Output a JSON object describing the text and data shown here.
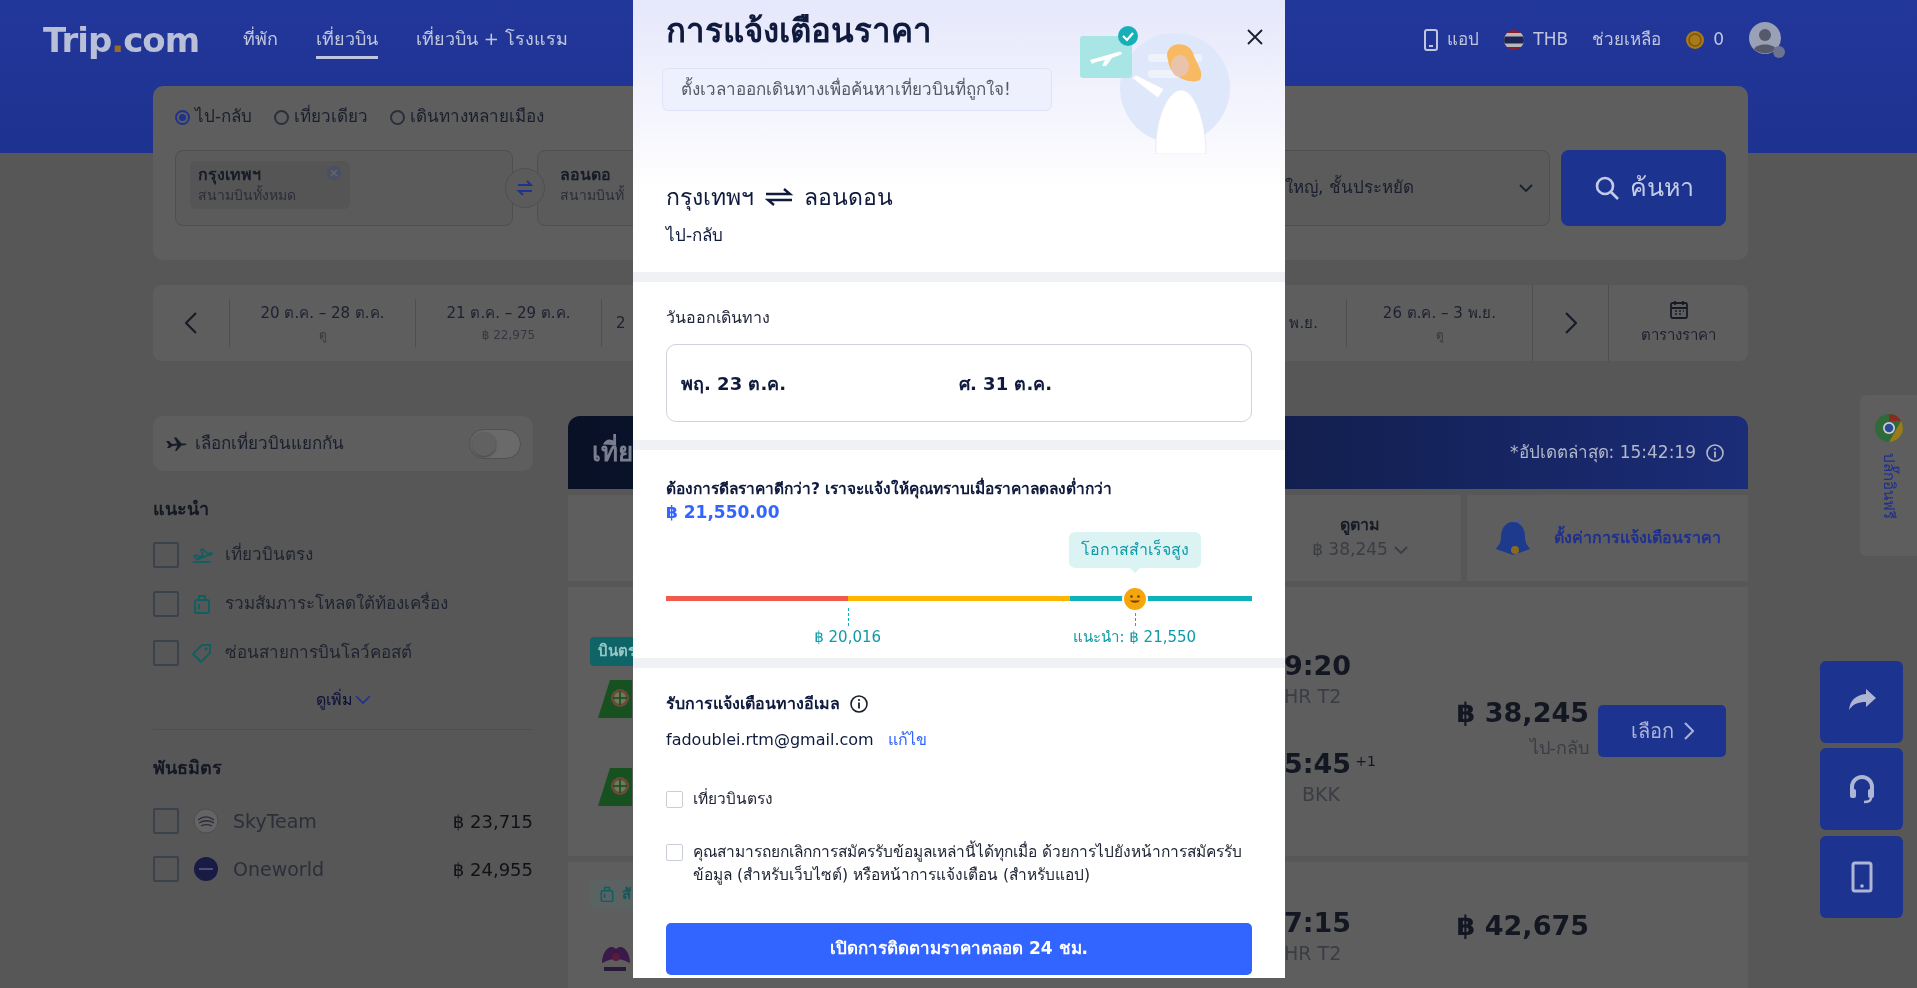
{
  "header": {
    "logo": [
      "Trip",
      ".",
      "com"
    ],
    "nav": [
      {
        "label": "ที่พัก",
        "selected": false
      },
      {
        "label": "เที่ยวบิน",
        "selected": true
      },
      {
        "label": "เที่ยวบิน + โรงแรม",
        "selected": false
      }
    ],
    "app": "แอป",
    "currency": "THB",
    "help": "ช่วยเหลือ",
    "coins": "0"
  },
  "search": {
    "trip_types": [
      {
        "label": "ไป-กลับ",
        "selected": true
      },
      {
        "label": "เที่ยวเดียว",
        "selected": false
      },
      {
        "label": "เดินทางหลายเมือง",
        "selected": false
      }
    ],
    "from": {
      "city": "กรุงเทพฯ",
      "airport": "สนามบินทั้งหมด"
    },
    "to": {
      "city": "ลอนดอ",
      "airport": "สนามบินทั้"
    },
    "passengers": "ใหญ่, ชั้นประหยัด",
    "search_button": "ค้นหา"
  },
  "date_strip": {
    "left_cells": [
      {
        "dates": "20 ต.ค. – 28 ต.ค.",
        "price": "ดู"
      },
      {
        "dates": "21 ต.ค. – 29 ต.ค.",
        "price": "฿ 22,975"
      },
      {
        "dates": "2"
      }
    ],
    "right_cells": [
      {
        "dates": "พ.ย."
      },
      {
        "dates": "26 ต.ค. – 3 พ.ย.",
        "price": "ดู"
      }
    ],
    "calendar": "ตารางราคา"
  },
  "sidebar": {
    "toggle": {
      "label": "เลือกเที่ยวบินแยกกัน",
      "on": false
    },
    "recommended": {
      "title": "แนะนำ",
      "items": [
        {
          "label": "เที่ยวบินตรง",
          "checked": false,
          "kind": "direct"
        },
        {
          "label": "รวมสัมภาระโหลดใต้ท้องเครื่อง",
          "checked": false,
          "kind": "baggage"
        },
        {
          "label": "ซ่อนสายการบินโลว์คอสต์",
          "checked": false,
          "kind": "tag"
        }
      ],
      "more": "ดูเพิ่ม"
    },
    "alliances": {
      "title": "พันธมิตร",
      "items": [
        {
          "name": "SkyTeam",
          "price": "฿ 23,715",
          "checked": false,
          "kind": "skyteam"
        },
        {
          "name": "Oneworld",
          "price": "฿ 24,955",
          "checked": false,
          "kind": "oneworld"
        }
      ]
    }
  },
  "results": {
    "banner_title": "เที่ย",
    "updated": "*อัปเดตล่าสุด: 15:42:19",
    "sort_tab": {
      "label": "ดูตาม",
      "price": "฿ 38,245"
    },
    "alert_tab": "ตั้งค่าการแจ้งเตือนราคา",
    "flights": [
      {
        "tag": "บินตร",
        "kind": "direct",
        "legs": [
          {
            "kind": "tail",
            "time": "9:20",
            "airport": "HR T2"
          },
          {
            "kind": "tail",
            "time": "5:45",
            "day_offset": "+1",
            "airport": "BKK"
          }
        ],
        "price": "฿ 38,245",
        "trip": "ไป-กลับ",
        "button": "เลือก"
      },
      {
        "tag": "สั",
        "kind": "baggage",
        "legs": [
          {
            "kind": "emblem",
            "time": "7:15",
            "airport": "HR T2"
          }
        ],
        "price": "฿ 42,675"
      }
    ]
  },
  "plugin_tab": "ปลั๊กอินฟรี",
  "modal": {
    "title": "การแจ้งเตือนราคา",
    "hint": "ตั้งเวลาออกเดินทางเพื่อค้นหาเที่ยวบินที่ถูกใจ!",
    "route": {
      "from": "กรุงเทพฯ",
      "to": "ลอนดอน",
      "trip": "ไป-กลับ"
    },
    "dates": {
      "label": "วันออกเดินทาง",
      "depart": "พฤ. 23 ต.ค.",
      "return": "ศ. 31 ต.ค."
    },
    "target": {
      "text": "ต้องการดีลราคาดีกว่า? เราจะแจ้งให้คุณทราบเมื่อราคาลดลงต่ำกว่า",
      "price": "฿ 21,550.00",
      "tooltip": "โอกาสสำเร็จสูง",
      "level": 0.8,
      "low_mark": "฿ 20,016",
      "recommended_mark": "แนะนำ: ฿ 21,550"
    },
    "email": {
      "title": "รับการแจ้งเตือนทางอีเมล",
      "address": "fadoublei.rtm@gmail.com",
      "edit": "แก้ไข"
    },
    "options": [
      {
        "label": "เที่ยวบินตรง",
        "checked": false
      },
      {
        "label": "คุณสามารถยกเลิกการสมัครรับข้อมูลเหล่านี้ได้ทุกเมื่อ ด้วยการไปยังหน้าการสมัครรับข้อมูล (สำหรับเว็บไซต์) หรือหน้าการแจ้งเตือน (สำหรับแอป)",
        "checked": false
      }
    ],
    "submit": "เปิดการติดตามราคาตลอด 24 ชม."
  }
}
